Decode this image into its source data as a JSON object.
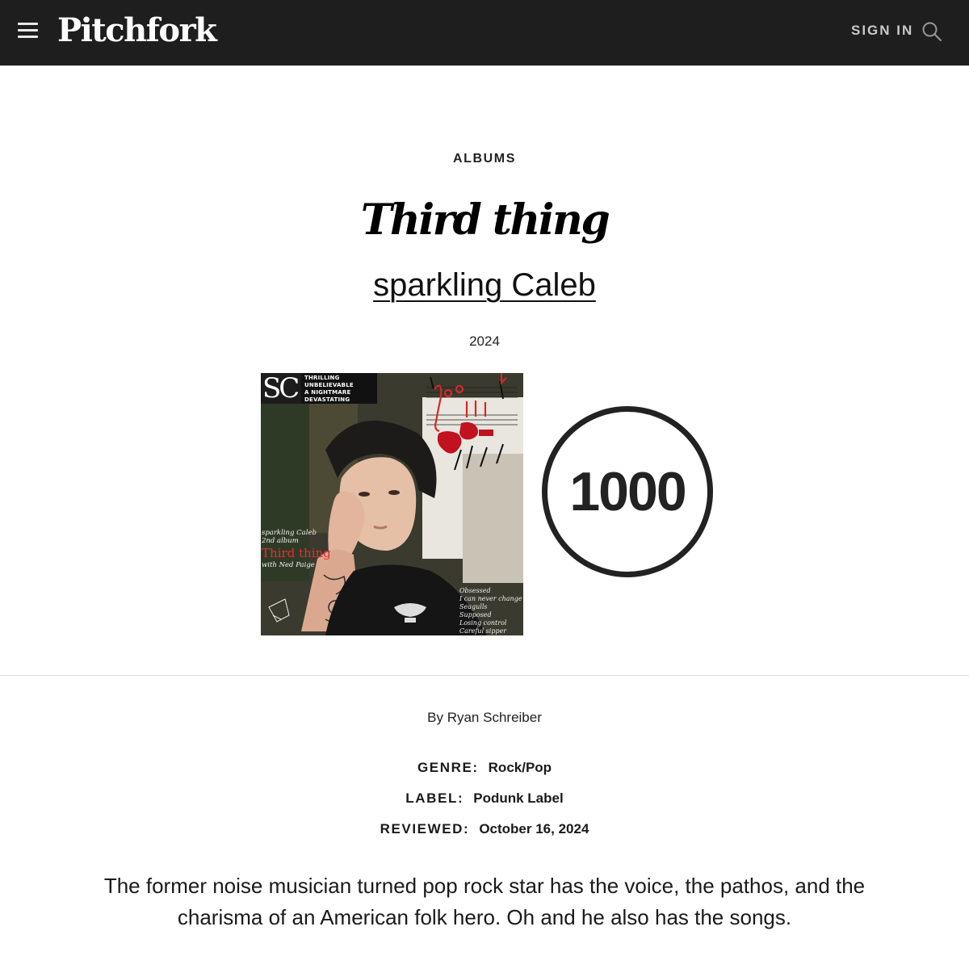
{
  "nav": {
    "logo": "Pitchfork",
    "sign_in": "SIGN IN"
  },
  "review": {
    "kicker": "ALBUMS",
    "title": "Third thing",
    "artist": "sparkling Caleb",
    "year": "2024",
    "score": "1000",
    "byline_prefix": "By",
    "author": "Ryan Schreiber",
    "meta": {
      "genre_label": "GENRE:",
      "genre": "Rock/Pop",
      "label_label": "LABEL:",
      "label": "Podunk Label",
      "reviewed_label": "REVIEWED:",
      "reviewed": "October 16, 2024"
    },
    "dek": "The former noise musician turned pop rock star has the voice, the pathos, and the charisma of an American folk hero. Oh and he also has the songs."
  },
  "cover": {
    "logo": "SC",
    "taglines": [
      "THRILLING",
      "UNBELIEVABLE",
      "A NIGHTMARE",
      "DEVASTATING"
    ],
    "artist_line": "sparkling Caleb",
    "album_number": "2nd album",
    "album_title": "Third thing",
    "with_line": "with Ned Paige",
    "tracks": [
      "Obsessed",
      "I can never change",
      "Seagulls",
      "Supposed",
      "Losing control",
      "Careful sipper"
    ]
  },
  "colors": {
    "nav_bg": "#1e1e1e",
    "accent_red": "#e03131",
    "text": "#111111"
  },
  "icons": {
    "menu": "hamburger-menu-icon",
    "search": "search-icon"
  }
}
